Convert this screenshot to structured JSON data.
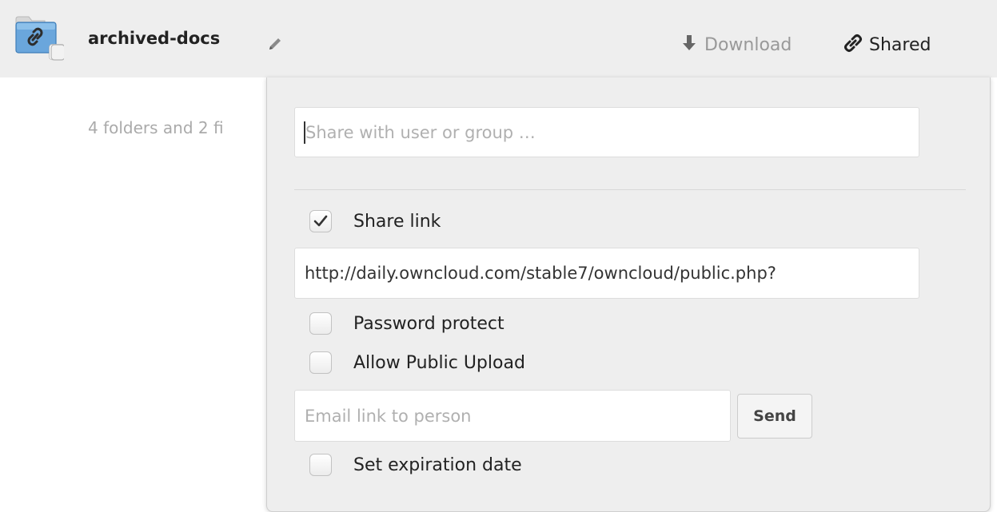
{
  "file": {
    "name": "archived-docs",
    "summary": "4 folders and 2 fi",
    "download_label": "Download",
    "shared_label": "Shared",
    "icons": {
      "folder": "shared-folder-icon",
      "rename": "pencil-icon",
      "download": "download-arrow-icon",
      "shared": "link-icon"
    }
  },
  "share_panel": {
    "search_placeholder": "Share with user or group …",
    "share_link": {
      "label": "Share link",
      "checked": true
    },
    "link_url": "http://daily.owncloud.com/stable7/owncloud/public.php?",
    "password_protect": {
      "label": "Password protect",
      "checked": false
    },
    "allow_public_upload": {
      "label": "Allow Public Upload",
      "checked": false
    },
    "email": {
      "placeholder": "Email link to person",
      "send_label": "Send"
    },
    "expiration": {
      "label": "Set expiration date",
      "checked": false
    }
  },
  "colors": {
    "row_background": "#eeeeee",
    "folder_blue": "#5b9bd5",
    "muted_text": "#999999",
    "text": "#222222"
  }
}
